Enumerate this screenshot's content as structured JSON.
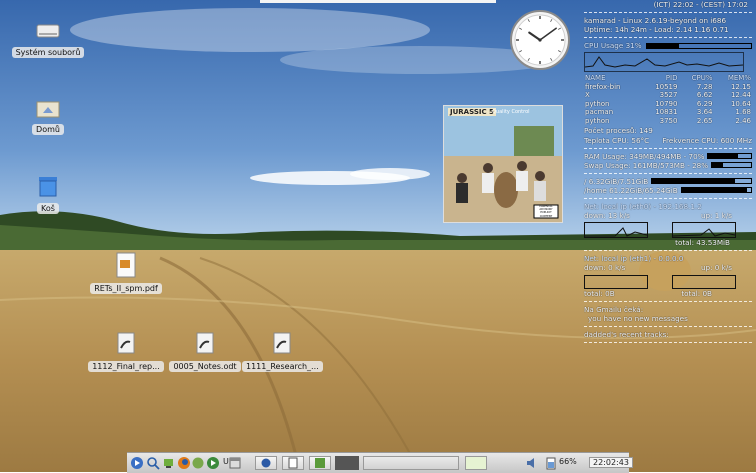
{
  "desktop": {
    "icons": [
      {
        "label": "Systém souborů",
        "icon": "drive-icon"
      },
      {
        "label": "Domů",
        "icon": "home-folder-icon"
      },
      {
        "label": "Koš",
        "icon": "trash-icon"
      },
      {
        "label": "RETs_II_spm.pdf",
        "icon": "pdf-file-icon"
      },
      {
        "label": "1112_Final_rep...",
        "icon": "document-link-icon"
      },
      {
        "label": "0005_Notes.odt",
        "icon": "document-link-icon"
      },
      {
        "label": "1111_Research_...",
        "icon": "document-link-icon"
      }
    ],
    "clock": {
      "hour": 10,
      "minute": 9
    }
  },
  "conky": {
    "time_line": "(ICT) 22:02 - (CEST) 17:02",
    "host_line": "kamarad - Linux 2.6.19-beyond on i686",
    "uptime_line": "Uptime: 14h 24m  - Load: 2.14 1.16 0.71",
    "cpu_label": "CPU Usage 31%",
    "cpu_usage": 31,
    "proc_headers": [
      "NAME",
      "PID",
      "CPU%",
      "MEM%"
    ],
    "processes": [
      [
        "firefox-bin",
        "10519",
        "7.28",
        "12.15"
      ],
      [
        "X",
        "3527",
        "6.62",
        "12.44"
      ],
      [
        "python",
        "10790",
        "6.29",
        "10.64"
      ],
      [
        "pacman",
        "10831",
        "3.64",
        "1.68"
      ],
      [
        "python",
        "3750",
        "2.65",
        "2.46"
      ]
    ],
    "proc_count_line": "Počet procesů: 149",
    "cpu_temp_line": "Teplota CPU: 56°C",
    "cpu_freq_line": "Frekvence CPU: 600 MHz",
    "ram_line": "RAM Usage: 349MB/494MB - 70%",
    "ram_usage": 70,
    "swap_line": "Swap Usage: 161MB/573MB - 28%",
    "swap_usage": 28,
    "disk_root_line": "/ 6.32GiB/7.51GiB",
    "disk_root_usage": 84,
    "disk_home_line": "/home 61.22GiB/65.24GiB",
    "disk_home_usage": 94,
    "net1_line": "Net: local ip (eth0) - 192.168.1.2",
    "net1_down": "down: 13 k/s",
    "net1_up": "up: 1 k/s",
    "net1_total_up": "total: 43.53MiB",
    "net2_line": "Net: local ip (eth1) - 0.0.0.0",
    "net2_down": "down: 0 k/s",
    "net2_up": "up: 0 k/s",
    "net2_total_down": "total: 0B",
    "net2_total_up": "total: 0B",
    "mail_line": "Na Gmailu čeká:",
    "mail_status": "you have no new messages",
    "tracks_line": "dadded's recent tracks:"
  },
  "album": {
    "label_top": "JURASSIC 5",
    "label_sub": "Quality Control",
    "advisory": "PARENTAL ADVISORY EXPLICIT CONTENT"
  },
  "taskbar": {
    "keyboard_layout": "US",
    "battery": "66%",
    "clock": "22:02:43"
  },
  "colors": {
    "sky_top": "#3d6fb0",
    "sky_bottom": "#a8c8e8",
    "field": "#b89a5e"
  }
}
